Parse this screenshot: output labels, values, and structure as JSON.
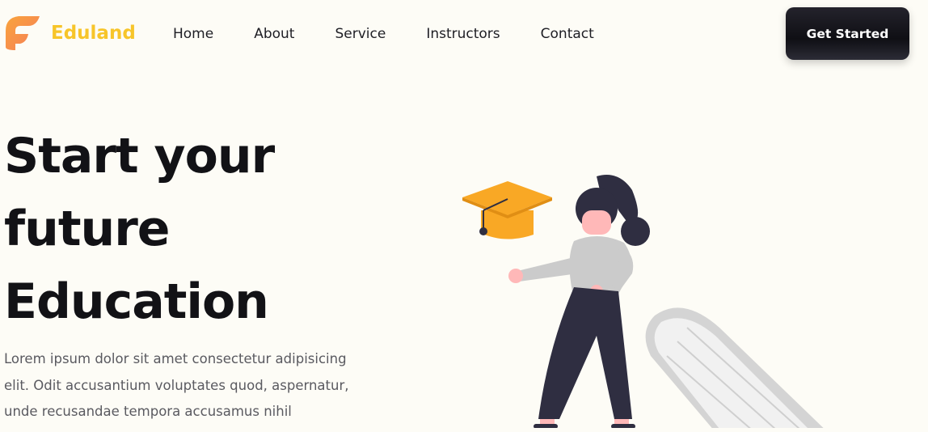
{
  "brand": {
    "name": "Eduland",
    "logo_icon": "eduland-logo-icon",
    "accent_color": "#f7c52a",
    "logo_color": "#f7944a"
  },
  "nav": {
    "items": [
      {
        "label": "Home"
      },
      {
        "label": "About"
      },
      {
        "label": "Service"
      },
      {
        "label": "Instructors"
      },
      {
        "label": "Contact"
      }
    ],
    "cta_label": "Get Started"
  },
  "hero": {
    "title_lines": [
      "Start your",
      "future",
      "Education"
    ],
    "description": "Lorem ipsum dolor sit amet consectetur adipisicing elit. Odit accusantium voluptates quod, aspernatur, unde recusandae tempora accusamus nihil"
  },
  "illustration": {
    "icons": [
      "graduation-cap-icon",
      "student-figure",
      "pencil-icon"
    ],
    "cap_color": "#f9a825"
  }
}
